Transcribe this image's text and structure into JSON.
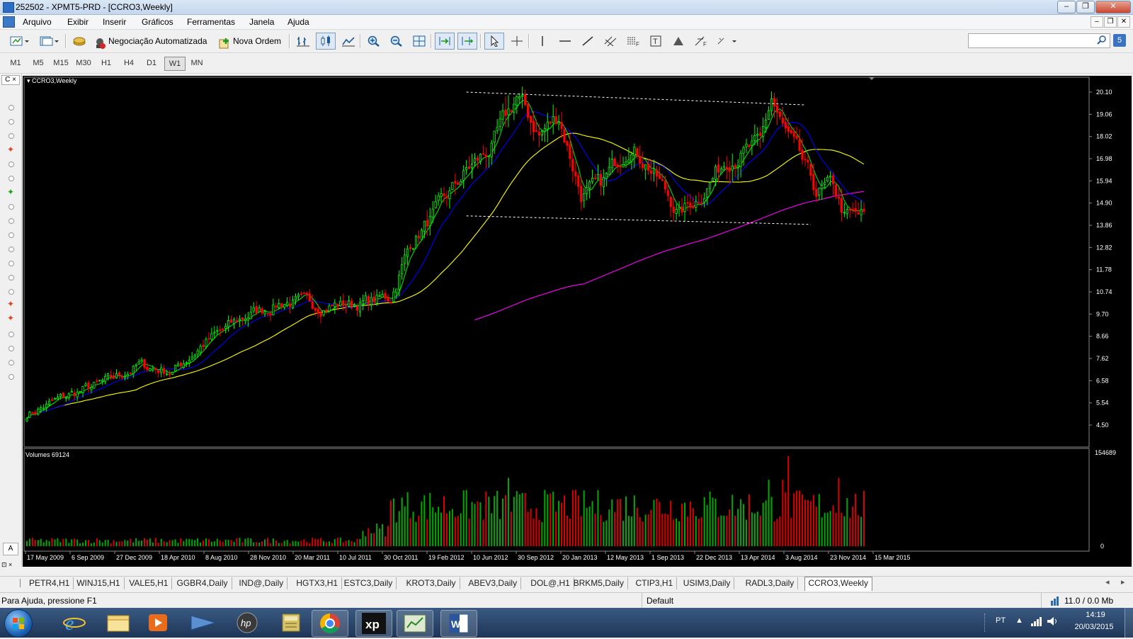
{
  "window": {
    "title": "252502 - XPMT5-PRD - [CCRO3,Weekly]"
  },
  "menu": [
    "Arquivo",
    "Exibir",
    "Inserir",
    "Gráficos",
    "Ferramentas",
    "Janela",
    "Ajuda"
  ],
  "toolbar": {
    "auto_trading_label": "Negociação Automatizada",
    "new_order_label": "Nova Ordem"
  },
  "timeframes": [
    "M1",
    "M5",
    "M15",
    "M30",
    "H1",
    "H4",
    "D1",
    "W1",
    "MN"
  ],
  "active_timeframe": "W1",
  "chart_data": {
    "type": "candlestick",
    "title": "CCRO3,Weekly",
    "volume_label": "Volumes 69124",
    "y_ticks": [
      "20.10",
      "19.06",
      "18.02",
      "16.98",
      "15.94",
      "14.90",
      "13.86",
      "12.82",
      "11.78",
      "10.74",
      "9.70",
      "8.66",
      "7.62",
      "6.58",
      "5.54",
      "4.50"
    ],
    "ylim": [
      4.5,
      20.1
    ],
    "volume_ticks": [
      "154689",
      "0"
    ],
    "volume_max": 154689,
    "x_ticks": [
      "17 May 2009",
      "6 Sep 2009",
      "27 Dec 2009",
      "18 Apr 2010",
      "8 Aug 2010",
      "28 Nov 2010",
      "20 Mar 2011",
      "10 Jul 2011",
      "30 Oct 2011",
      "19 Feb 2012",
      "10 Jun 2012",
      "30 Sep 2012",
      "20 Jan 2013",
      "12 May 2013",
      "1 Sep 2013",
      "22 Dec 2013",
      "13 Apr 2014",
      "3 Aug 2014",
      "23 Nov 2014",
      "15 Mar 2015"
    ],
    "price_path": [
      [
        0,
        5.0
      ],
      [
        15,
        5.9
      ],
      [
        30,
        6.6
      ],
      [
        40,
        7.3
      ],
      [
        52,
        7.0
      ],
      [
        63,
        8.3
      ],
      [
        78,
        9.6
      ],
      [
        92,
        10.3
      ],
      [
        105,
        10.1
      ],
      [
        119,
        10.2
      ],
      [
        130,
        10.5
      ],
      [
        137,
        13.0
      ],
      [
        147,
        14.6
      ],
      [
        157,
        16.4
      ],
      [
        166,
        17.5
      ],
      [
        175,
        19.9
      ],
      [
        183,
        18.1
      ],
      [
        190,
        19.0
      ],
      [
        198,
        15.3
      ],
      [
        205,
        15.7
      ],
      [
        215,
        17.7
      ],
      [
        222,
        16.7
      ],
      [
        233,
        14.4
      ],
      [
        240,
        15.2
      ],
      [
        250,
        17.0
      ],
      [
        262,
        17.6
      ],
      [
        266,
        19.8
      ],
      [
        270,
        18.4
      ],
      [
        276,
        17.0
      ],
      [
        282,
        15.4
      ],
      [
        288,
        15.7
      ],
      [
        292,
        14.3
      ]
    ],
    "ma_colors": {
      "fast": "#00dd00",
      "mid": "#0000ff",
      "slow": "#ffff00",
      "long": "#ff00ff"
    },
    "candle_colors": {
      "up": "#00ff00",
      "down": "#ff0000"
    },
    "volume_colors": {
      "up": "#00aa00",
      "down": "#dd0000"
    },
    "trendlines": [
      {
        "from": [
          157,
          20.1
        ],
        "to": [
          278,
          19.5
        ]
      },
      {
        "from": [
          157,
          14.3
        ],
        "to": [
          280,
          13.9
        ]
      }
    ]
  },
  "symbol_tabs": [
    "PETR4,H1",
    "WINJ15,H1",
    "VALE5,H1",
    "GGBR4,Daily",
    "IND@,Daily",
    "HGTX3,H1",
    "ESTC3,Daily",
    "KROT3,Daily",
    "ABEV3,Daily",
    "DOL@,H1",
    "BRKM5,Daily",
    "CTIP3,H1",
    "USIM3,Daily",
    "RADL3,Daily",
    "CCRO3,Weekly"
  ],
  "active_tab": "CCRO3,Weekly",
  "status": {
    "help": "Para Ajuda, pressione F1",
    "profile": "Default",
    "traffic": "11.0 / 0.0 Mb"
  },
  "taskbar": {
    "lang": "PT",
    "time": "14:19",
    "date": "20/03/2015",
    "apps": [
      "windows-start",
      "internet-explorer",
      "file-explorer",
      "media-player",
      "outlook",
      "hp",
      "calculator",
      "chrome",
      "xp-trader",
      "metatrader",
      "word"
    ]
  }
}
